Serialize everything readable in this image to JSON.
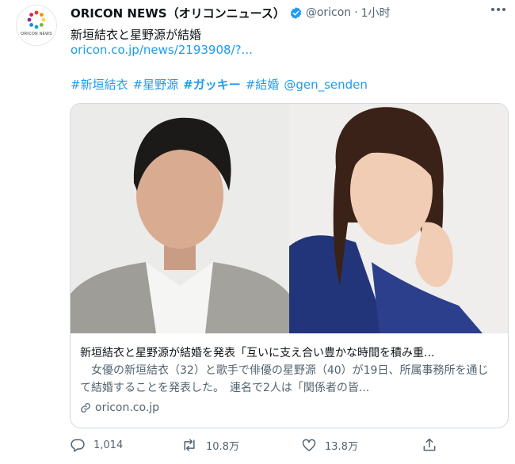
{
  "tweet": {
    "author_name": "ORICON NEWS（オリコンニュース）",
    "handle": "@oricon",
    "separator": "·",
    "time": "1小时",
    "text": "新垣結衣と星野源が結婚",
    "link": "oricon.co.jp/news/2193908/?...",
    "hashtags": [
      {
        "text": "#新垣結衣",
        "bold": false
      },
      {
        "text": "#星野源",
        "bold": false
      },
      {
        "text": "#ガッキー",
        "bold": true
      },
      {
        "text": "#結婚",
        "bold": false
      },
      {
        "text": "@gen_senden",
        "bold": false
      }
    ]
  },
  "avatar": {
    "logo_text": "ORICON NEWS",
    "icon": "oricon-logo-icon"
  },
  "card": {
    "title": "新垣結衣と星野源が結婚を発表「互いに支え合い豊かな時間を積み重...",
    "description": "　女優の新垣結衣（32）と歌手で俳優の星野源（40）が19日、所属事務所を通じて結婚することを発表した。　連名で2人は「関係者の皆...",
    "domain": "oricon.co.jp",
    "image_alt": "photo of a man and a woman"
  },
  "actions": {
    "reply_count": "1,014",
    "retweet_count": "10.8万",
    "like_count": "13.8万"
  },
  "colors": {
    "link": "#1d9bf0",
    "secondary_text": "#536471",
    "border": "#cfd9de",
    "verified": "#1d9bf0"
  }
}
